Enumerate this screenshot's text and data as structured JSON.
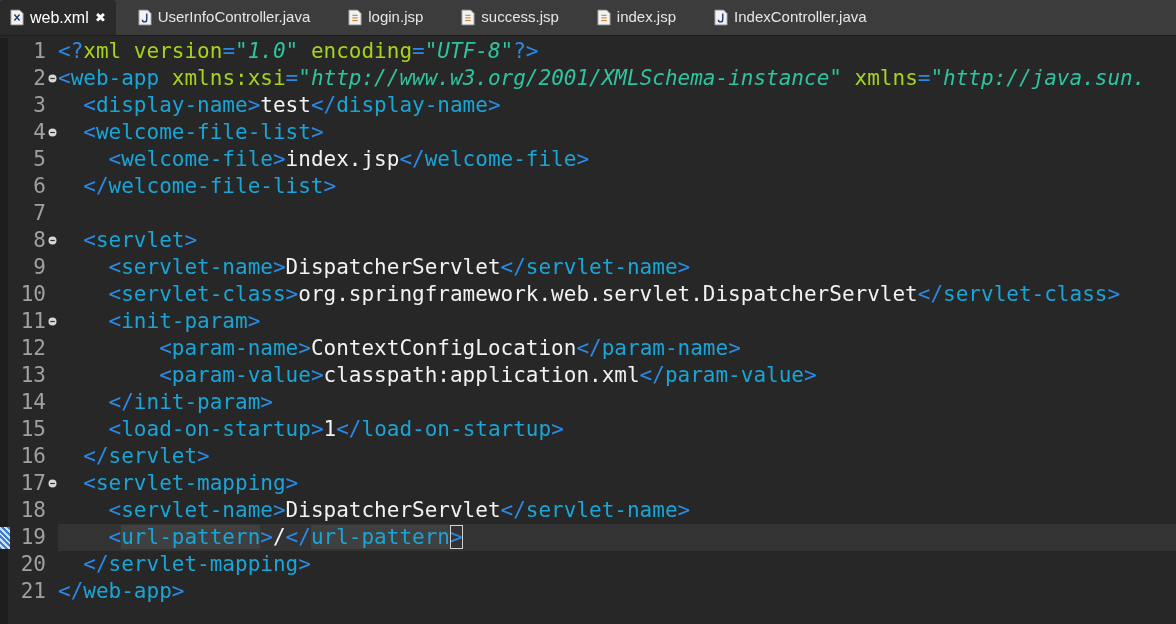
{
  "tabs": [
    {
      "label": "web.xml",
      "kind": "xml",
      "selected": true,
      "close": "✖"
    },
    {
      "label": "UserInfoController.java",
      "kind": "java",
      "selected": false
    },
    {
      "label": "login.jsp",
      "kind": "jsp",
      "selected": false
    },
    {
      "label": "success.jsp",
      "kind": "jsp",
      "selected": false
    },
    {
      "label": "index.jsp",
      "kind": "jsp",
      "selected": false
    },
    {
      "label": "IndexController.java",
      "kind": "java",
      "selected": false
    }
  ],
  "lines": [
    {
      "number": "1",
      "foldable": false,
      "current": false,
      "tokens": [
        {
          "kind": "bracket",
          "text": "<?"
        },
        {
          "kind": "attr",
          "text": "xml version"
        },
        {
          "kind": "bracket",
          "text": "="
        },
        {
          "kind": "value",
          "text": "\"1.0\""
        },
        {
          "kind": "attr",
          "text": " encoding"
        },
        {
          "kind": "bracket",
          "text": "="
        },
        {
          "kind": "value",
          "text": "\"UTF-8\""
        },
        {
          "kind": "bracket",
          "text": "?>"
        }
      ]
    },
    {
      "number": "2",
      "foldable": true,
      "current": false,
      "tokens": [
        {
          "kind": "bracket",
          "text": "<"
        },
        {
          "kind": "tag",
          "text": "web-app"
        },
        {
          "kind": "attr",
          "text": " xmlns:xsi"
        },
        {
          "kind": "bracket",
          "text": "="
        },
        {
          "kind": "value",
          "text": "\"http://www.w3.org/2001/XMLSchema-instance\""
        },
        {
          "kind": "attr",
          "text": " xmlns"
        },
        {
          "kind": "bracket",
          "text": "="
        },
        {
          "kind": "value",
          "text": "\"http://java.sun."
        }
      ]
    },
    {
      "number": "3",
      "foldable": false,
      "current": false,
      "tokens": [
        {
          "kind": "bracket",
          "text": "  <"
        },
        {
          "kind": "tag",
          "text": "display-name"
        },
        {
          "kind": "bracket",
          "text": ">"
        },
        {
          "kind": "text",
          "text": "test"
        },
        {
          "kind": "bracket",
          "text": "</"
        },
        {
          "kind": "tag",
          "text": "display-name"
        },
        {
          "kind": "bracket",
          "text": ">"
        }
      ]
    },
    {
      "number": "4",
      "foldable": true,
      "current": false,
      "tokens": [
        {
          "kind": "bracket",
          "text": "  <"
        },
        {
          "kind": "tag",
          "text": "welcome-file-list"
        },
        {
          "kind": "bracket",
          "text": ">"
        }
      ]
    },
    {
      "number": "5",
      "foldable": false,
      "current": false,
      "tokens": [
        {
          "kind": "bracket",
          "text": "    <"
        },
        {
          "kind": "tag",
          "text": "welcome-file"
        },
        {
          "kind": "bracket",
          "text": ">"
        },
        {
          "kind": "text",
          "text": "index.jsp"
        },
        {
          "kind": "bracket",
          "text": "</"
        },
        {
          "kind": "tag",
          "text": "welcome-file"
        },
        {
          "kind": "bracket",
          "text": ">"
        }
      ]
    },
    {
      "number": "6",
      "foldable": false,
      "current": false,
      "tokens": [
        {
          "kind": "bracket",
          "text": "  </"
        },
        {
          "kind": "tag",
          "text": "welcome-file-list"
        },
        {
          "kind": "bracket",
          "text": ">"
        }
      ]
    },
    {
      "number": "7",
      "foldable": false,
      "current": false
    },
    {
      "number": "8",
      "foldable": true,
      "current": false,
      "tokens": [
        {
          "kind": "bracket",
          "text": "  <"
        },
        {
          "kind": "tag",
          "text": "servlet"
        },
        {
          "kind": "bracket",
          "text": ">"
        }
      ]
    },
    {
      "number": "9",
      "foldable": false,
      "current": false,
      "tokens": [
        {
          "kind": "bracket",
          "text": "    <"
        },
        {
          "kind": "tag",
          "text": "servlet-name"
        },
        {
          "kind": "bracket",
          "text": ">"
        },
        {
          "kind": "text",
          "text": "DispatcherServlet"
        },
        {
          "kind": "bracket",
          "text": "</"
        },
        {
          "kind": "tag",
          "text": "servlet-name"
        },
        {
          "kind": "bracket",
          "text": ">"
        }
      ]
    },
    {
      "number": "10",
      "foldable": false,
      "current": false,
      "tokens": [
        {
          "kind": "bracket",
          "text": "    <"
        },
        {
          "kind": "tag",
          "text": "servlet-class"
        },
        {
          "kind": "bracket",
          "text": ">"
        },
        {
          "kind": "text",
          "text": "org.springframework.web.servlet.DispatcherServlet"
        },
        {
          "kind": "bracket",
          "text": "</"
        },
        {
          "kind": "tag",
          "text": "servlet-class"
        },
        {
          "kind": "bracket",
          "text": ">"
        }
      ]
    },
    {
      "number": "11",
      "foldable": true,
      "current": false,
      "tokens": [
        {
          "kind": "bracket",
          "text": "    <"
        },
        {
          "kind": "tag",
          "text": "init-param"
        },
        {
          "kind": "bracket",
          "text": ">"
        }
      ]
    },
    {
      "number": "12",
      "foldable": false,
      "current": false,
      "tokens": [
        {
          "kind": "bracket",
          "text": "        <"
        },
        {
          "kind": "tag",
          "text": "param-name"
        },
        {
          "kind": "bracket",
          "text": ">"
        },
        {
          "kind": "text",
          "text": "ContextConfigLocation"
        },
        {
          "kind": "bracket",
          "text": "</"
        },
        {
          "kind": "tag",
          "text": "param-name"
        },
        {
          "kind": "bracket",
          "text": ">"
        }
      ]
    },
    {
      "number": "13",
      "foldable": false,
      "current": false,
      "tokens": [
        {
          "kind": "bracket",
          "text": "        <"
        },
        {
          "kind": "tag",
          "text": "param-value"
        },
        {
          "kind": "bracket",
          "text": ">"
        },
        {
          "kind": "text",
          "text": "classpath:application.xml"
        },
        {
          "kind": "bracket",
          "text": "</"
        },
        {
          "kind": "tag",
          "text": "param-value"
        },
        {
          "kind": "bracket",
          "text": ">"
        }
      ]
    },
    {
      "number": "14",
      "foldable": false,
      "current": false,
      "tokens": [
        {
          "kind": "bracket",
          "text": "    </"
        },
        {
          "kind": "tag",
          "text": "init-param"
        },
        {
          "kind": "bracket",
          "text": ">"
        }
      ]
    },
    {
      "number": "15",
      "foldable": false,
      "current": false,
      "tokens": [
        {
          "kind": "bracket",
          "text": "    <"
        },
        {
          "kind": "tag",
          "text": "load-on-startup"
        },
        {
          "kind": "bracket",
          "text": ">"
        },
        {
          "kind": "text",
          "text": "1"
        },
        {
          "kind": "bracket",
          "text": "</"
        },
        {
          "kind": "tag",
          "text": "load-on-startup"
        },
        {
          "kind": "bracket",
          "text": ">"
        }
      ]
    },
    {
      "number": "16",
      "foldable": false,
      "current": false,
      "tokens": [
        {
          "kind": "bracket",
          "text": "  </"
        },
        {
          "kind": "tag",
          "text": "servlet"
        },
        {
          "kind": "bracket",
          "text": ">"
        }
      ]
    },
    {
      "number": "17",
      "foldable": true,
      "current": false,
      "tokens": [
        {
          "kind": "bracket",
          "text": "  <"
        },
        {
          "kind": "tag",
          "text": "servlet-mapping"
        },
        {
          "kind": "bracket",
          "text": ">"
        }
      ]
    },
    {
      "number": "18",
      "foldable": false,
      "current": false,
      "tokens": [
        {
          "kind": "bracket",
          "text": "    <"
        },
        {
          "kind": "tag",
          "text": "servlet-name"
        },
        {
          "kind": "bracket",
          "text": ">"
        },
        {
          "kind": "text",
          "text": "DispatcherServlet"
        },
        {
          "kind": "bracket",
          "text": "</"
        },
        {
          "kind": "tag",
          "text": "servlet-name"
        },
        {
          "kind": "bracket",
          "text": ">"
        }
      ]
    },
    {
      "number": "19",
      "foldable": false,
      "current": true,
      "tokens": [
        {
          "kind": "bracket",
          "text": "    <"
        },
        {
          "kind": "tag-match",
          "text": "url-pattern"
        },
        {
          "kind": "bracket",
          "text": ">"
        },
        {
          "kind": "text",
          "text": "/"
        },
        {
          "kind": "bracket",
          "text": "</"
        },
        {
          "kind": "tag-match",
          "text": "url-pattern"
        },
        {
          "kind": "bracket-match",
          "text": ">"
        }
      ]
    },
    {
      "number": "20",
      "foldable": false,
      "current": false,
      "tokens": [
        {
          "kind": "bracket",
          "text": "  </"
        },
        {
          "kind": "tag",
          "text": "servlet-mapping"
        },
        {
          "kind": "bracket",
          "text": ">"
        }
      ]
    },
    {
      "number": "21",
      "foldable": false,
      "current": false,
      "tokens": [
        {
          "kind": "bracket",
          "text": "</"
        },
        {
          "kind": "tag",
          "text": "web-app"
        },
        {
          "kind": "bracket",
          "text": ">"
        }
      ]
    }
  ]
}
